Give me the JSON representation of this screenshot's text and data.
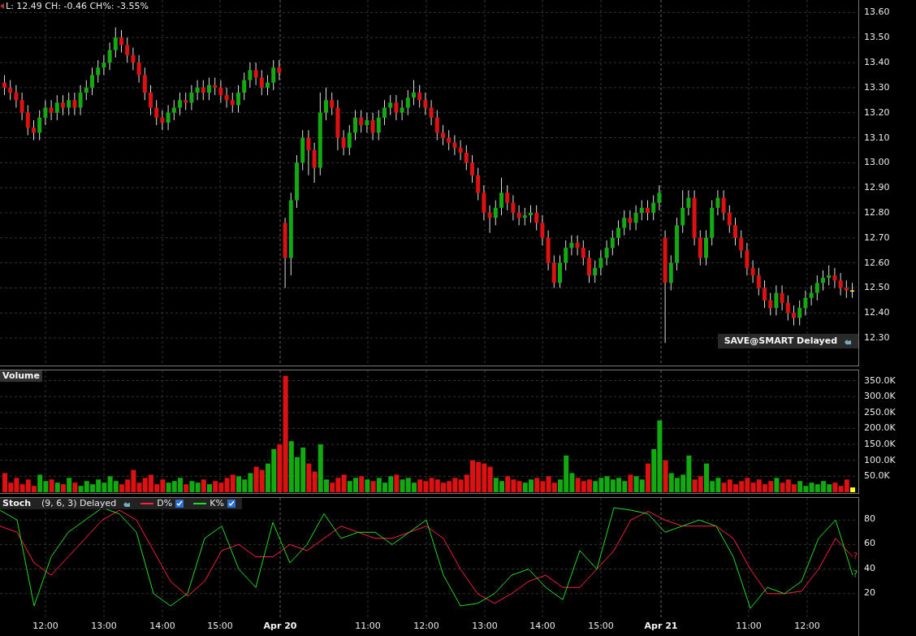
{
  "header": {
    "quote": "L: 12.49 CH: -0.46 CH%: -3.55%"
  },
  "price_panel": {
    "badge": "SAVE@SMART Delayed",
    "chart_data": {
      "type": "candlestick",
      "ylim": [
        12.19,
        13.65
      ],
      "grid": true,
      "yticks": [
        {
          "value": 13.6,
          "label": "13.60"
        },
        {
          "value": 13.5,
          "label": "13.50"
        },
        {
          "value": 13.4,
          "label": "13.40"
        },
        {
          "value": 13.3,
          "label": "13.30"
        },
        {
          "value": 13.2,
          "label": "13.20"
        },
        {
          "value": 13.1,
          "label": "13.10"
        },
        {
          "value": 13.0,
          "label": "13.00"
        },
        {
          "value": 12.9,
          "label": "12.90"
        },
        {
          "value": 12.8,
          "label": "12.80"
        },
        {
          "value": 12.7,
          "label": "12.70"
        },
        {
          "value": 12.6,
          "label": "12.60"
        },
        {
          "value": 12.5,
          "label": "12.50"
        },
        {
          "value": 12.4,
          "label": "12.40"
        },
        {
          "value": 12.3,
          "label": "12.30"
        }
      ],
      "ohlc": [
        [
          13.32,
          13.35,
          13.27,
          13.3
        ],
        [
          13.3,
          13.33,
          13.25,
          13.28
        ],
        [
          13.28,
          13.31,
          13.22,
          13.25
        ],
        [
          13.25,
          13.28,
          13.17,
          13.2
        ],
        [
          13.2,
          13.23,
          13.11,
          13.14
        ],
        [
          13.14,
          13.17,
          13.09,
          13.12
        ],
        [
          13.12,
          13.21,
          13.09,
          13.18
        ],
        [
          13.18,
          13.25,
          13.15,
          13.22
        ],
        [
          13.22,
          13.25,
          13.17,
          13.2
        ],
        [
          13.2,
          13.27,
          13.17,
          13.24
        ],
        [
          13.24,
          13.27,
          13.19,
          13.22
        ],
        [
          13.22,
          13.28,
          13.19,
          13.25
        ],
        [
          13.25,
          13.28,
          13.19,
          13.22
        ],
        [
          13.22,
          13.31,
          13.19,
          13.28
        ],
        [
          13.28,
          13.33,
          13.25,
          13.3
        ],
        [
          13.3,
          13.38,
          13.27,
          13.35
        ],
        [
          13.35,
          13.41,
          13.32,
          13.38
        ],
        [
          13.38,
          13.43,
          13.35,
          13.4
        ],
        [
          13.4,
          13.48,
          13.37,
          13.45
        ],
        [
          13.45,
          13.54,
          13.42,
          13.5
        ],
        [
          13.5,
          13.53,
          13.44,
          13.47
        ],
        [
          13.47,
          13.5,
          13.4,
          13.43
        ],
        [
          13.43,
          13.46,
          13.37,
          13.4
        ],
        [
          13.4,
          13.43,
          13.32,
          13.35
        ],
        [
          13.35,
          13.38,
          13.25,
          13.28
        ],
        [
          13.28,
          13.31,
          13.19,
          13.22
        ],
        [
          13.22,
          13.25,
          13.15,
          13.18
        ],
        [
          13.18,
          13.21,
          13.13,
          13.16
        ],
        [
          13.16,
          13.23,
          13.13,
          13.2
        ],
        [
          13.2,
          13.25,
          13.17,
          13.22
        ],
        [
          13.22,
          13.28,
          13.19,
          13.25
        ],
        [
          13.25,
          13.28,
          13.21,
          13.24
        ],
        [
          13.24,
          13.31,
          13.21,
          13.28
        ],
        [
          13.28,
          13.33,
          13.25,
          13.3
        ],
        [
          13.3,
          13.33,
          13.25,
          13.28
        ],
        [
          13.28,
          13.34,
          13.25,
          13.31
        ],
        [
          13.31,
          13.34,
          13.27,
          13.3
        ],
        [
          13.3,
          13.33,
          13.24,
          13.27
        ],
        [
          13.27,
          13.3,
          13.22,
          13.25
        ],
        [
          13.25,
          13.28,
          13.2,
          13.23
        ],
        [
          13.23,
          13.31,
          13.2,
          13.28
        ],
        [
          13.28,
          13.36,
          13.25,
          13.33
        ],
        [
          13.33,
          13.4,
          13.3,
          13.37
        ],
        [
          13.37,
          13.4,
          13.31,
          13.34
        ],
        [
          13.34,
          13.37,
          13.27,
          13.3
        ],
        [
          13.3,
          13.35,
          13.27,
          13.32
        ],
        [
          13.32,
          13.41,
          13.29,
          13.38
        ],
        [
          13.38,
          13.41,
          13.33,
          13.36
        ],
        [
          12.76,
          12.78,
          12.5,
          12.62
        ],
        [
          12.62,
          12.88,
          12.55,
          12.85
        ],
        [
          12.85,
          13.03,
          12.82,
          13.0
        ],
        [
          13.0,
          13.13,
          12.97,
          13.1
        ],
        [
          13.1,
          13.13,
          12.95,
          13.05
        ],
        [
          13.05,
          13.08,
          12.92,
          12.98
        ],
        [
          12.98,
          13.28,
          12.95,
          13.2
        ],
        [
          13.2,
          13.3,
          13.17,
          13.25
        ],
        [
          13.25,
          13.28,
          13.19,
          13.22
        ],
        [
          13.22,
          13.25,
          13.05,
          13.1
        ],
        [
          13.1,
          13.13,
          13.03,
          13.06
        ],
        [
          13.06,
          13.15,
          13.03,
          13.12
        ],
        [
          13.12,
          13.21,
          13.09,
          13.18
        ],
        [
          13.18,
          13.21,
          13.12,
          13.15
        ],
        [
          13.15,
          13.2,
          13.12,
          13.17
        ],
        [
          13.17,
          13.2,
          13.09,
          13.12
        ],
        [
          13.12,
          13.21,
          13.09,
          13.18
        ],
        [
          13.18,
          13.25,
          13.15,
          13.22
        ],
        [
          13.22,
          13.27,
          13.19,
          13.24
        ],
        [
          13.24,
          13.27,
          13.17,
          13.2
        ],
        [
          13.2,
          13.25,
          13.17,
          13.22
        ],
        [
          13.22,
          13.29,
          13.19,
          13.26
        ],
        [
          13.26,
          13.33,
          13.23,
          13.28
        ],
        [
          13.28,
          13.31,
          13.22,
          13.25
        ],
        [
          13.25,
          13.28,
          13.19,
          13.22
        ],
        [
          13.22,
          13.25,
          13.15,
          13.18
        ],
        [
          13.18,
          13.21,
          13.09,
          13.12
        ],
        [
          13.12,
          13.15,
          13.07,
          13.1
        ],
        [
          13.1,
          13.13,
          13.05,
          13.08
        ],
        [
          13.08,
          13.11,
          13.03,
          13.06
        ],
        [
          13.06,
          13.09,
          13.01,
          13.04
        ],
        [
          13.04,
          13.07,
          12.97,
          13.0
        ],
        [
          13.0,
          13.03,
          12.92,
          12.95
        ],
        [
          12.95,
          12.98,
          12.85,
          12.88
        ],
        [
          12.88,
          12.91,
          12.77,
          12.8
        ],
        [
          12.8,
          12.83,
          12.72,
          12.78
        ],
        [
          12.78,
          12.85,
          12.75,
          12.82
        ],
        [
          12.82,
          12.94,
          12.79,
          12.88
        ],
        [
          12.88,
          12.91,
          12.81,
          12.84
        ],
        [
          12.84,
          12.87,
          12.77,
          12.8
        ],
        [
          12.8,
          12.83,
          12.75,
          12.78
        ],
        [
          12.78,
          12.82,
          12.75,
          12.79
        ],
        [
          12.79,
          12.83,
          12.76,
          12.8
        ],
        [
          12.8,
          12.83,
          12.73,
          12.76
        ],
        [
          12.76,
          12.79,
          12.67,
          12.7
        ],
        [
          12.7,
          12.73,
          12.57,
          12.6
        ],
        [
          12.6,
          12.63,
          12.5,
          12.52
        ],
        [
          12.52,
          12.63,
          12.5,
          12.6
        ],
        [
          12.6,
          12.69,
          12.57,
          12.66
        ],
        [
          12.66,
          12.71,
          12.63,
          12.68
        ],
        [
          12.68,
          12.71,
          12.63,
          12.66
        ],
        [
          12.66,
          12.69,
          12.59,
          12.62
        ],
        [
          12.62,
          12.65,
          12.52,
          12.55
        ],
        [
          12.55,
          12.61,
          12.52,
          12.58
        ],
        [
          12.58,
          12.65,
          12.55,
          12.62
        ],
        [
          12.62,
          12.69,
          12.59,
          12.66
        ],
        [
          12.66,
          12.73,
          12.63,
          12.7
        ],
        [
          12.7,
          12.77,
          12.67,
          12.74
        ],
        [
          12.74,
          12.81,
          12.71,
          12.78
        ],
        [
          12.78,
          12.81,
          12.73,
          12.76
        ],
        [
          12.76,
          12.83,
          12.73,
          12.8
        ],
        [
          12.8,
          12.85,
          12.77,
          12.82
        ],
        [
          12.82,
          12.85,
          12.77,
          12.8
        ],
        [
          12.8,
          12.87,
          12.77,
          12.84
        ],
        [
          12.84,
          12.91,
          12.81,
          12.88
        ],
        [
          12.7,
          12.73,
          12.28,
          12.52
        ],
        [
          12.52,
          12.63,
          12.49,
          12.6
        ],
        [
          12.6,
          12.78,
          12.57,
          12.75
        ],
        [
          12.75,
          12.89,
          12.72,
          12.82
        ],
        [
          12.82,
          12.89,
          12.79,
          12.86
        ],
        [
          12.86,
          12.89,
          12.67,
          12.7
        ],
        [
          12.7,
          12.73,
          12.59,
          12.62
        ],
        [
          12.62,
          12.73,
          12.59,
          12.7
        ],
        [
          12.7,
          12.85,
          12.67,
          12.82
        ],
        [
          12.82,
          12.89,
          12.79,
          12.86
        ],
        [
          12.86,
          12.89,
          12.77,
          12.8
        ],
        [
          12.8,
          12.83,
          12.72,
          12.75
        ],
        [
          12.75,
          12.78,
          12.67,
          12.7
        ],
        [
          12.7,
          12.73,
          12.62,
          12.65
        ],
        [
          12.65,
          12.68,
          12.55,
          12.58
        ],
        [
          12.58,
          12.61,
          12.52,
          12.55
        ],
        [
          12.55,
          12.58,
          12.47,
          12.5
        ],
        [
          12.5,
          12.53,
          12.42,
          12.45
        ],
        [
          12.45,
          12.48,
          12.39,
          12.42
        ],
        [
          12.42,
          12.51,
          12.39,
          12.48
        ],
        [
          12.48,
          12.51,
          12.41,
          12.44
        ],
        [
          12.44,
          12.47,
          12.37,
          12.4
        ],
        [
          12.4,
          12.43,
          12.35,
          12.38
        ],
        [
          12.38,
          12.45,
          12.35,
          12.42
        ],
        [
          12.42,
          12.49,
          12.39,
          12.46
        ],
        [
          12.46,
          12.51,
          12.43,
          12.48
        ],
        [
          12.48,
          12.55,
          12.45,
          12.52
        ],
        [
          12.52,
          12.57,
          12.49,
          12.54
        ],
        [
          12.54,
          12.59,
          12.51,
          12.55
        ],
        [
          12.55,
          12.58,
          12.5,
          12.53
        ],
        [
          12.53,
          12.56,
          12.47,
          12.5
        ],
        [
          12.5,
          12.53,
          12.46,
          12.49
        ],
        [
          12.49,
          12.52,
          12.46,
          12.49
        ]
      ]
    }
  },
  "volume_panel": {
    "title": "Volume",
    "chart_data": {
      "type": "bar",
      "ylim": [
        0,
        382
      ],
      "grid": true,
      "yticks": [
        {
          "value": 350,
          "label": "350.0K"
        },
        {
          "value": 300,
          "label": "300.0K"
        },
        {
          "value": 250,
          "label": "250.0K"
        },
        {
          "value": 200,
          "label": "200.0K"
        },
        {
          "value": 150,
          "label": "150.0K"
        },
        {
          "value": 100,
          "label": "100.0K"
        },
        {
          "value": 50,
          "label": "50.0K"
        }
      ],
      "values": [
        60,
        30,
        45,
        25,
        40,
        20,
        55,
        35,
        40,
        30,
        25,
        45,
        30,
        20,
        35,
        25,
        40,
        30,
        50,
        35,
        25,
        40,
        70,
        30,
        45,
        55,
        25,
        40,
        30,
        35,
        45,
        25,
        35,
        30,
        40,
        25,
        35,
        30,
        45,
        55,
        50,
        40,
        60,
        80,
        70,
        90,
        135,
        150,
        365,
        160,
        110,
        140,
        90,
        65,
        150,
        40,
        30,
        45,
        55,
        35,
        45,
        50,
        40,
        35,
        45,
        30,
        50,
        55,
        40,
        45,
        30,
        40,
        35,
        45,
        40,
        30,
        35,
        45,
        40,
        55,
        100,
        95,
        90,
        80,
        45,
        35,
        50,
        40,
        35,
        30,
        40,
        45,
        35,
        50,
        30,
        40,
        115,
        60,
        45,
        35,
        40,
        35,
        45,
        50,
        40,
        45,
        35,
        55,
        50,
        40,
        90,
        135,
        225,
        100,
        60,
        45,
        55,
        115,
        40,
        50,
        90,
        35,
        45,
        30,
        40,
        25,
        35,
        45,
        30,
        40,
        25,
        35,
        45,
        30,
        40,
        25,
        35,
        20,
        30,
        25,
        35,
        25,
        30,
        20,
        40,
        15
      ]
    }
  },
  "stoch_panel": {
    "title": "Stoch",
    "params": "(9, 6, 3) Delayed",
    "legend": [
      {
        "checked": true,
        "end_mark": "?"
      },
      {
        "checked": true,
        "end_mark": "?"
      }
    ],
    "chart_data": {
      "type": "line",
      "grid": true,
      "legend": "top-left",
      "yticks": [
        {
          "value": 80,
          "label": "80"
        },
        {
          "value": 60,
          "label": "60"
        },
        {
          "value": 40,
          "label": "40"
        },
        {
          "value": 20,
          "label": "20"
        }
      ],
      "ylim": [
        0,
        98
      ],
      "series": [
        {
          "name": "D%",
          "color": "#ff2040",
          "values": [
            75,
            70,
            45,
            35,
            50,
            65,
            80,
            88,
            80,
            55,
            30,
            18,
            30,
            55,
            60,
            50,
            50,
            60,
            55,
            65,
            75,
            70,
            65,
            65,
            70,
            75,
            65,
            40,
            20,
            12,
            20,
            30,
            35,
            25,
            25,
            40,
            55,
            80,
            87,
            80,
            75,
            75,
            75,
            65,
            40,
            20,
            20,
            22,
            40,
            65,
            50
          ]
        },
        {
          "name": "K%",
          "color": "#22dd22",
          "values": [
            88,
            80,
            10,
            50,
            70,
            80,
            90,
            85,
            70,
            20,
            10,
            20,
            65,
            75,
            40,
            25,
            78,
            45,
            60,
            85,
            65,
            70,
            70,
            60,
            70,
            80,
            35,
            10,
            12,
            20,
            35,
            40,
            25,
            15,
            55,
            40,
            90,
            88,
            85,
            70,
            75,
            80,
            75,
            50,
            8,
            25,
            20,
            30,
            65,
            80,
            35
          ]
        }
      ]
    }
  },
  "time_axis": [
    {
      "label": "12:00",
      "kind": "time"
    },
    {
      "label": "13:00",
      "kind": "time"
    },
    {
      "label": "14:00",
      "kind": "time"
    },
    {
      "label": "15:00",
      "kind": "time"
    },
    {
      "label": "Apr 20",
      "kind": "day"
    },
    {
      "label": "11:00",
      "kind": "time"
    },
    {
      "label": "12:00",
      "kind": "time"
    },
    {
      "label": "13:00",
      "kind": "time"
    },
    {
      "label": "14:00",
      "kind": "time"
    },
    {
      "label": "15:00",
      "kind": "time"
    },
    {
      "label": "Apr 21",
      "kind": "day"
    },
    {
      "label": "11:00",
      "kind": "time"
    },
    {
      "label": "12:00",
      "kind": "time"
    }
  ]
}
